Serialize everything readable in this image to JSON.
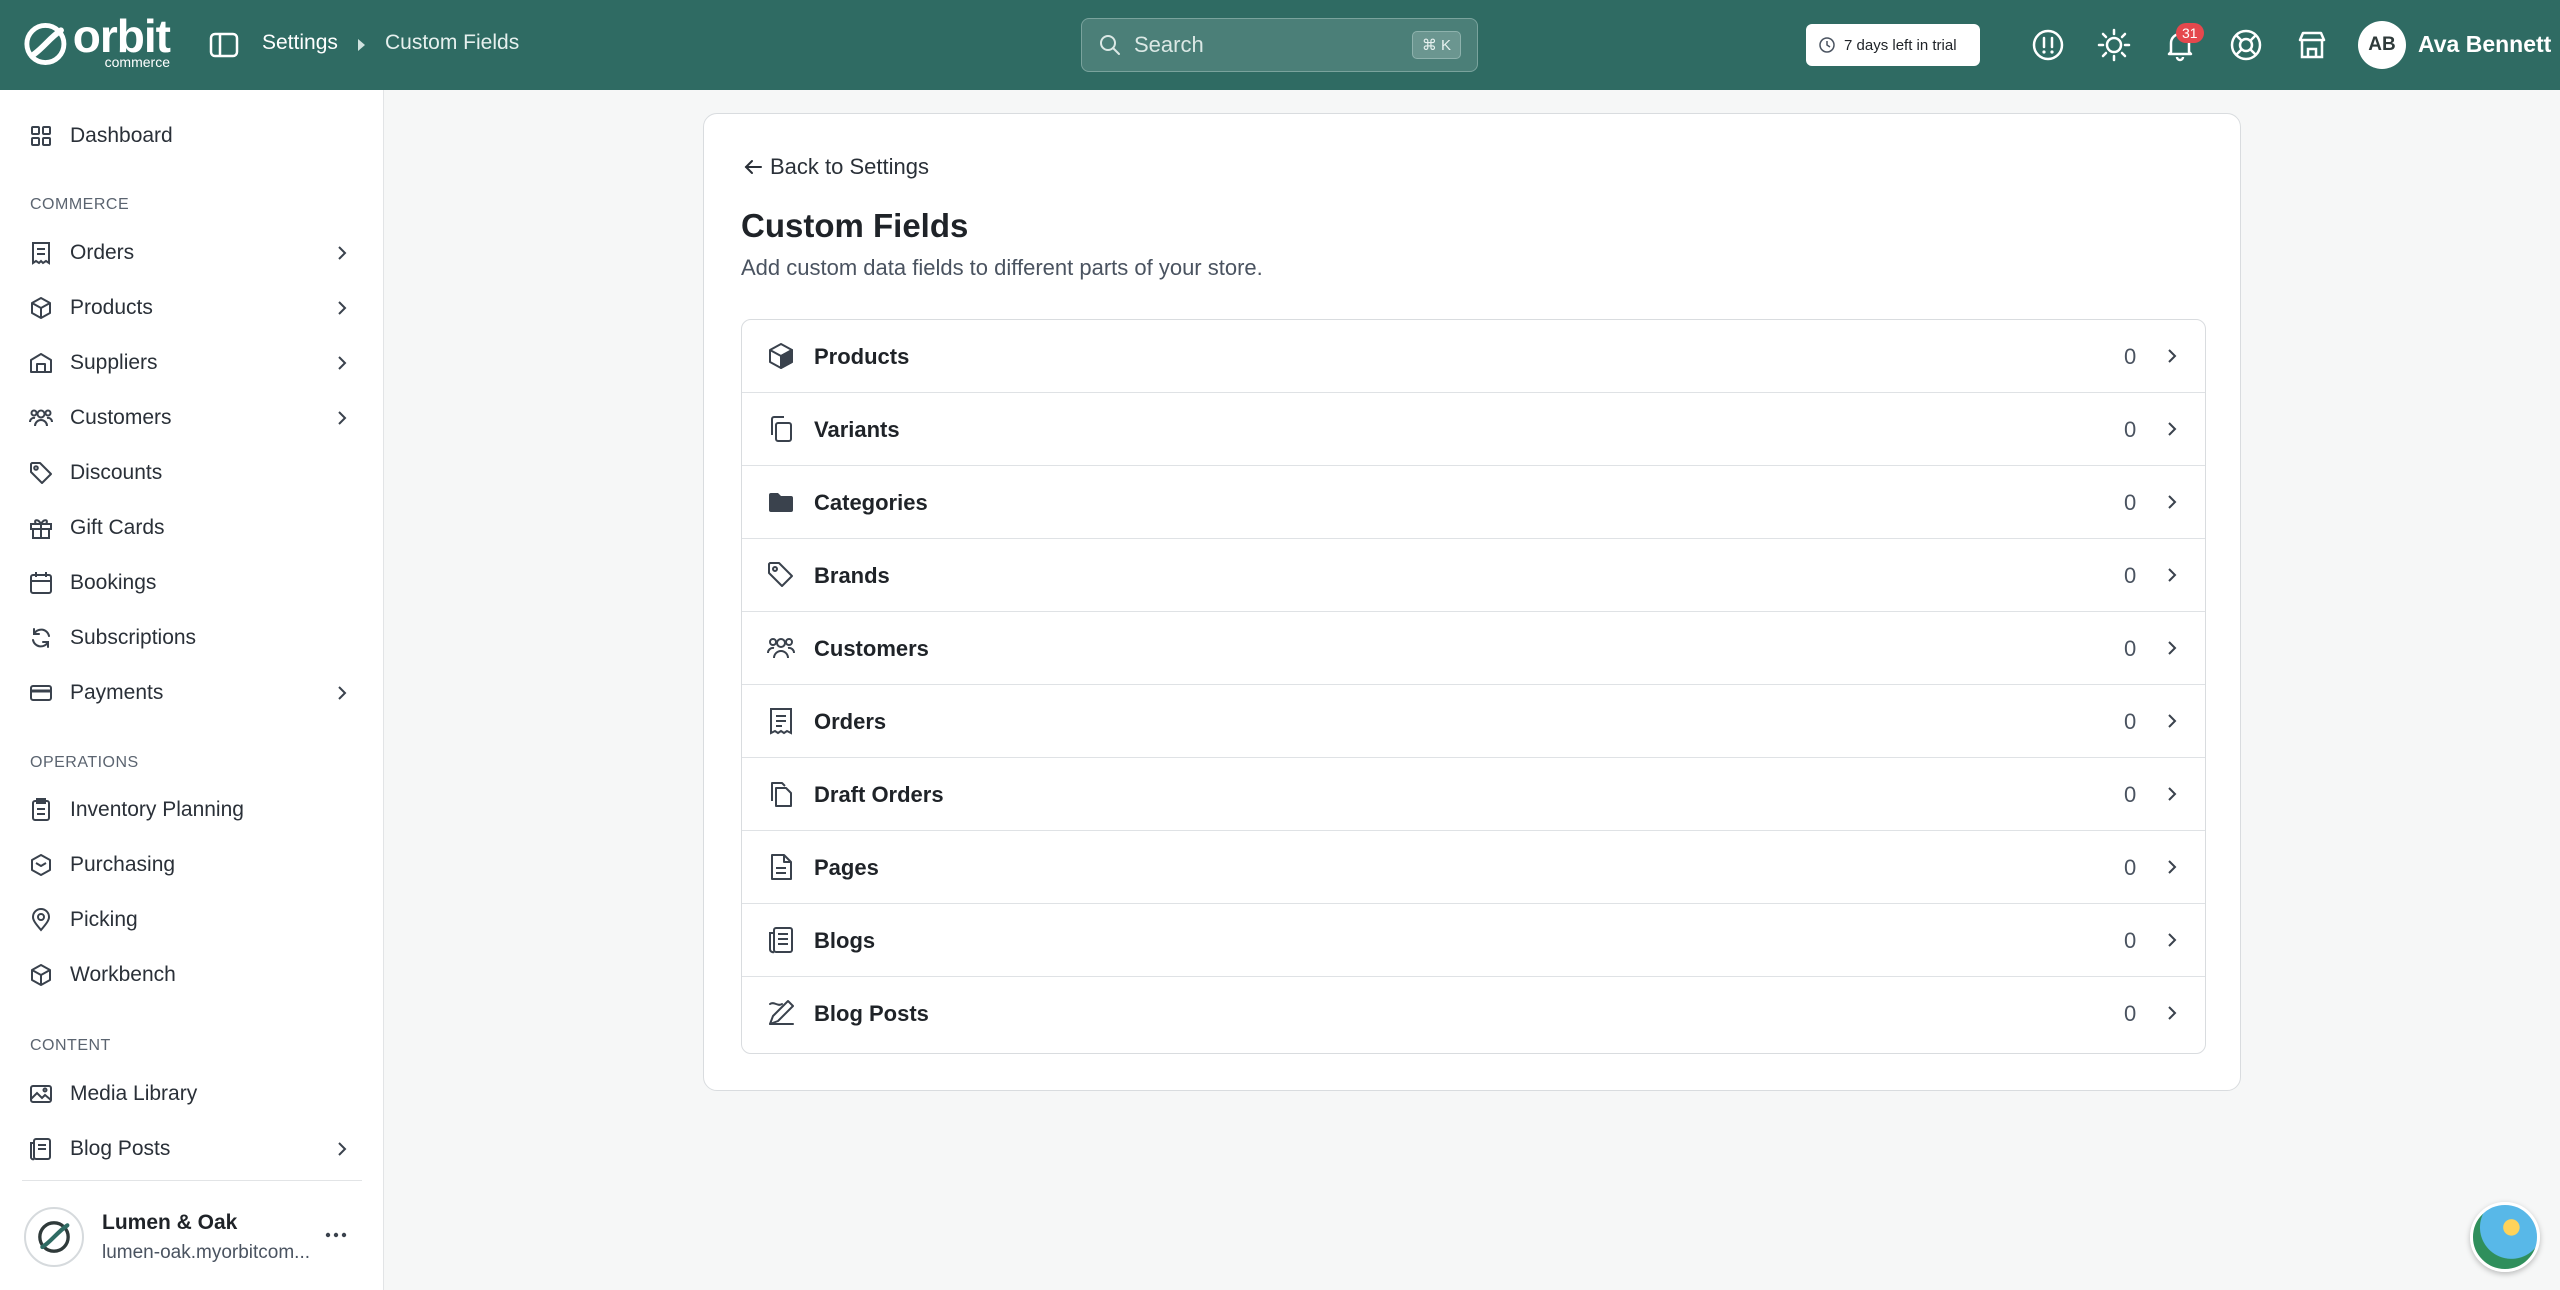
{
  "topbar": {
    "logo_word": "orbit",
    "logo_sub": "commerce",
    "breadcrumb": [
      "Settings",
      "Custom Fields"
    ],
    "search_placeholder": "Search",
    "search_shortcut": "⌘ K",
    "trial_text": "7 days left in trial",
    "notifications_count": "31",
    "user_initials": "AB",
    "user_name": "Ava Bennett",
    "bg_color": "#2f6b63"
  },
  "sidebar": {
    "items_top": [
      {
        "label": "Dashboard",
        "icon": "dashboard-icon"
      }
    ],
    "section_commerce": "COMMERCE",
    "commerce": [
      {
        "label": "Orders",
        "icon": "receipt-icon",
        "expandable": true
      },
      {
        "label": "Products",
        "icon": "box-icon",
        "expandable": true
      },
      {
        "label": "Suppliers",
        "icon": "suppliers-icon",
        "expandable": true
      },
      {
        "label": "Customers",
        "icon": "users-icon",
        "expandable": true
      },
      {
        "label": "Discounts",
        "icon": "tag-icon",
        "expandable": false
      },
      {
        "label": "Gift Cards",
        "icon": "gift-icon",
        "expandable": false
      },
      {
        "label": "Bookings",
        "icon": "calendar-icon",
        "expandable": false
      },
      {
        "label": "Subscriptions",
        "icon": "refresh-icon",
        "expandable": false
      },
      {
        "label": "Payments",
        "icon": "card-icon",
        "expandable": true
      }
    ],
    "section_operations": "OPERATIONS",
    "operations": [
      {
        "label": "Inventory Planning",
        "icon": "clipboard-icon"
      },
      {
        "label": "Purchasing",
        "icon": "purchasing-icon"
      },
      {
        "label": "Picking",
        "icon": "pin-icon"
      },
      {
        "label": "Workbench",
        "icon": "cube-icon"
      }
    ],
    "section_content": "CONTENT",
    "content": [
      {
        "label": "Media Library",
        "icon": "image-icon",
        "expandable": false
      },
      {
        "label": "Blog Posts",
        "icon": "blog-icon",
        "expandable": true
      }
    ],
    "store": {
      "name": "Lumen & Oak",
      "url": "lumen-oak.myorbitcom..."
    }
  },
  "main": {
    "back_label": "Back to Settings",
    "title": "Custom Fields",
    "subtitle": "Add custom data fields to different parts of your store.",
    "rows": [
      {
        "label": "Products",
        "count": "0",
        "icon": "box-icon"
      },
      {
        "label": "Variants",
        "count": "0",
        "icon": "copy-icon"
      },
      {
        "label": "Categories",
        "count": "0",
        "icon": "folder-icon"
      },
      {
        "label": "Brands",
        "count": "0",
        "icon": "tag-icon"
      },
      {
        "label": "Customers",
        "count": "0",
        "icon": "users-icon"
      },
      {
        "label": "Orders",
        "count": "0",
        "icon": "receipt-icon"
      },
      {
        "label": "Draft Orders",
        "count": "0",
        "icon": "draft-icon"
      },
      {
        "label": "Pages",
        "count": "0",
        "icon": "file-icon"
      },
      {
        "label": "Blogs",
        "count": "0",
        "icon": "blog-icon"
      },
      {
        "label": "Blog Posts",
        "count": "0",
        "icon": "pen-icon"
      }
    ]
  }
}
